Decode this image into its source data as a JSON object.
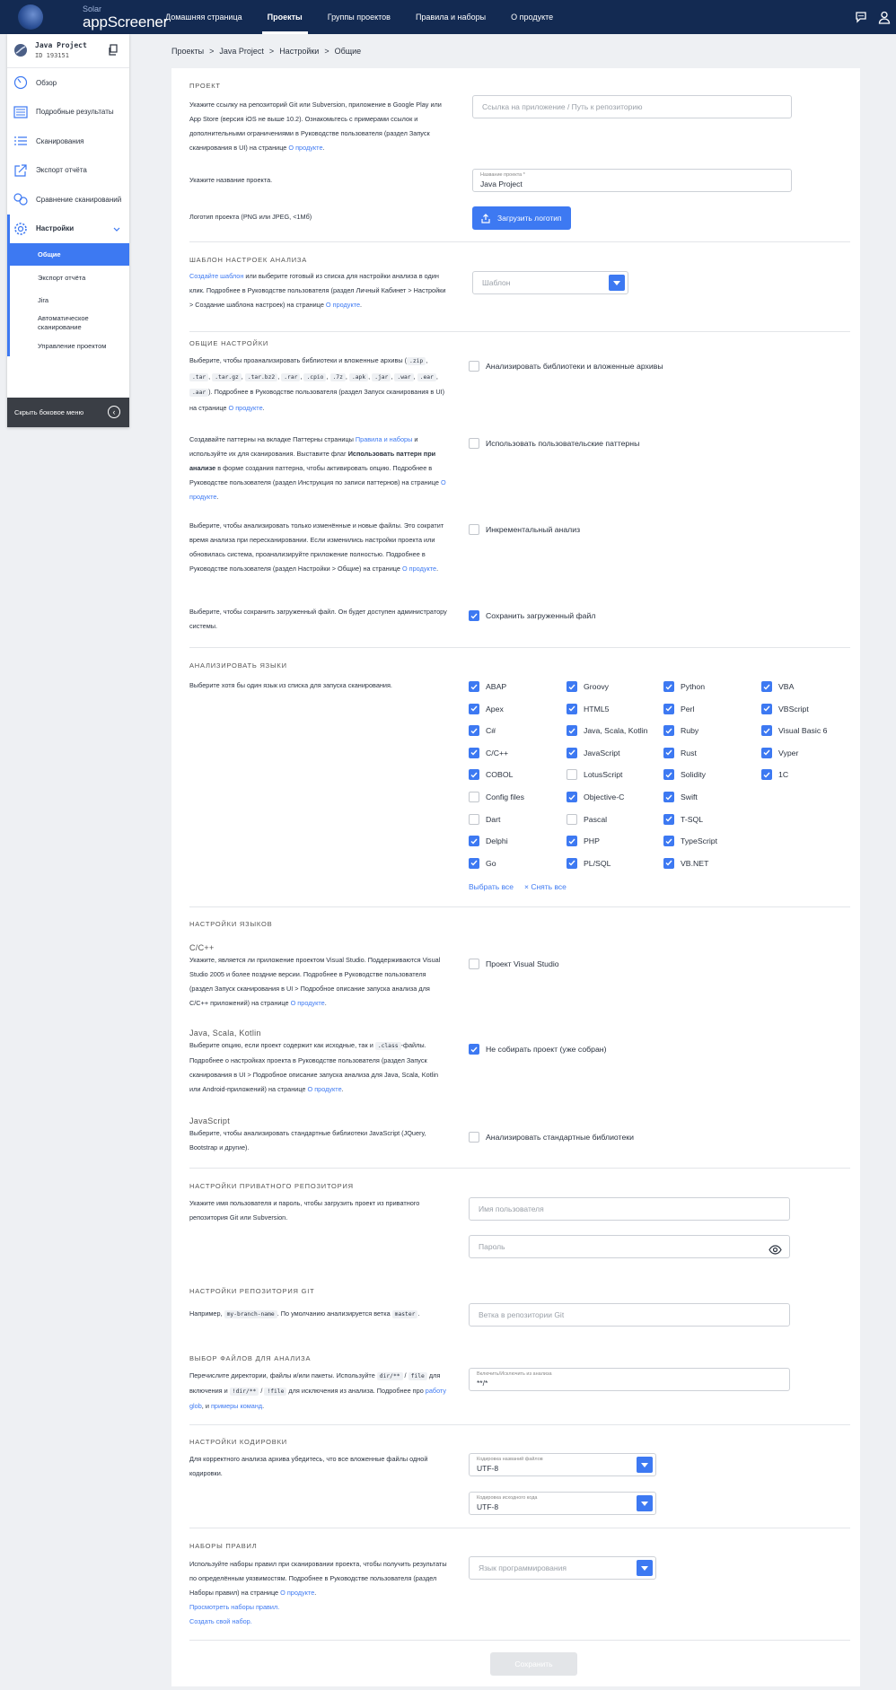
{
  "app": {
    "solar": "Solar",
    "name": "appScreener"
  },
  "topnav": [
    {
      "label": "Домашняя страница",
      "active": false
    },
    {
      "label": "Проекты",
      "active": true
    },
    {
      "label": "Группы проектов",
      "active": false
    },
    {
      "label": "Правила и наборы",
      "active": false
    },
    {
      "label": "О продукте",
      "active": false
    }
  ],
  "topbar_icons": [
    "chat-icon",
    "user-icon"
  ],
  "sidebar": {
    "project_name": "Java Project",
    "project_id": "ID 193151",
    "items": [
      {
        "label": "Обзор",
        "icon": "overview-icon"
      },
      {
        "label": "Подробные результаты",
        "icon": "results-icon"
      },
      {
        "label": "Сканирования",
        "icon": "scans-icon"
      },
      {
        "label": "Экспорт отчёта",
        "icon": "export-icon"
      },
      {
        "label": "Сравнение сканирований",
        "icon": "compare-icon"
      }
    ],
    "settings_label": "Настройки",
    "subitems": [
      {
        "label": "Общие",
        "active": true
      },
      {
        "label": "Экспорт отчёта",
        "active": false
      },
      {
        "label": "Jira",
        "active": false
      },
      {
        "label": "Автоматическое сканирование",
        "active": false
      },
      {
        "label": "Управление проектом",
        "active": false
      }
    ],
    "hide_label": "Скрыть боковое меню"
  },
  "breadcrumb": [
    "Проекты",
    ">",
    "Java Project",
    ">",
    "Настройки",
    ">",
    "Общие"
  ],
  "project_section": {
    "title": "ПРОЕКТ",
    "desc_1": "Укажите ссылку на репозиторий Git или Subversion, приложение в Google Play или App Store (версия iOS не выше 10.2). Ознакомьтесь с примерами ссылок и дополнительными ограничениями в Руководстве пользователя (раздел Запуск сканирования в UI) на странице ",
    "about_link": "О продукте",
    "dot": ".",
    "repo_placeholder": "Ссылка на приложение / Путь к репозиторию",
    "name_desc": "Укажите название проекта.",
    "name_label": "Название проекта *",
    "name_value": "Java Project",
    "logo_desc": "Логотип проекта (PNG или JPEG, <1Мб)",
    "logo_button": "Загрузить логотип"
  },
  "template_section": {
    "title": "ШАБЛОН НАСТРОЕК АНАЛИЗА",
    "link_create": "Создайте шаблон",
    "desc": " или выберите готовый из списка для настройки анализа в один клик. Подробнее в Руководстве пользователя (раздел Личный Кабинет > Настройки > Создание шаблона настроек) на странице ",
    "about_link": "О продукте",
    "dot": ".",
    "select_placeholder": "Шаблон"
  },
  "general_section": {
    "title": "ОБЩИЕ НАСТРОЙКИ",
    "archives_desc_a": "Выберите, чтобы проанализировать библиотеки и вложенные архивы (",
    "archive_exts": [
      ".zip",
      ".tar",
      ".tar.gz",
      ".tar.bz2",
      ".rar",
      ".cpio",
      ".7z",
      ".apk",
      ".jar",
      ".war",
      ".ear",
      ".aar"
    ],
    "archives_desc_b": "). Подробнее в Руководстве пользователя (раздел Запуск сканирования в UI) на странице ",
    "about_link": "О продукте",
    "dot": ".",
    "archives_cb": "Анализировать библиотеки и вложенные архивы",
    "patterns_desc_a": "Создавайте паттерны на вкладке Паттерны страницы ",
    "patterns_link": "Правила и наборы",
    "patterns_desc_b": " и используйте их для сканирования. Выставите флаг ",
    "patterns_bold": "Использовать паттерн при анализе",
    "patterns_desc_c": " в форме создания паттерна, чтобы активировать опцию. Подробнее в Руководстве пользователя (раздел Инструкция по записи паттернов) на странице ",
    "patterns_cb": "Использовать пользовательские паттерны",
    "incr_desc": "Выберите, чтобы анализировать только изменённые и новые файлы. Это сократит время анализа при пересканировании. Если изменились настройки проекта или обновилась система, проанализируйте приложение полностью. Подробнее в Руководстве пользователя (раздел Настройки > Общие) на странице ",
    "incr_cb": "Инкрементальный анализ",
    "save_desc": "Выберите, чтобы сохранить загруженный файл. Он будет доступен администратору системы.",
    "save_cb": "Сохранить загруженный файл"
  },
  "languages_section": {
    "title": "АНАЛИЗИРОВАТЬ ЯЗЫКИ",
    "desc": "Выберите хотя бы один язык из списка для запуска сканирования.",
    "columns": [
      [
        {
          "label": "ABAP",
          "on": true
        },
        {
          "label": "Apex",
          "on": true
        },
        {
          "label": "C#",
          "on": true
        },
        {
          "label": "C/C++",
          "on": true
        },
        {
          "label": "COBOL",
          "on": true
        },
        {
          "label": "Config files",
          "on": false
        },
        {
          "label": "Dart",
          "on": false
        },
        {
          "label": "Delphi",
          "on": true
        },
        {
          "label": "Go",
          "on": true
        }
      ],
      [
        {
          "label": "Groovy",
          "on": true
        },
        {
          "label": "HTML5",
          "on": true
        },
        {
          "label": "Java, Scala, Kotlin",
          "on": true
        },
        {
          "label": "JavaScript",
          "on": true
        },
        {
          "label": "LotusScript",
          "on": false
        },
        {
          "label": "Objective-C",
          "on": true
        },
        {
          "label": "Pascal",
          "on": false
        },
        {
          "label": "PHP",
          "on": true
        },
        {
          "label": "PL/SQL",
          "on": true
        }
      ],
      [
        {
          "label": "Python",
          "on": true
        },
        {
          "label": "Perl",
          "on": true
        },
        {
          "label": "Ruby",
          "on": true
        },
        {
          "label": "Rust",
          "on": true
        },
        {
          "label": "Solidity",
          "on": true
        },
        {
          "label": "Swift",
          "on": true
        },
        {
          "label": "T-SQL",
          "on": true
        },
        {
          "label": "TypeScript",
          "on": true
        },
        {
          "label": "VB.NET",
          "on": true
        }
      ],
      [
        {
          "label": "VBA",
          "on": true
        },
        {
          "label": "VBScript",
          "on": true
        },
        {
          "label": "Visual Basic 6",
          "on": true
        },
        {
          "label": "Vyper",
          "on": true
        },
        {
          "label": "1C",
          "on": true
        }
      ]
    ],
    "select_all": "Выбрать все",
    "deselect_all": "× Снять все"
  },
  "lang_settings_section": {
    "title": "НАСТРОЙКИ ЯЗЫКОВ",
    "cpp_title": "C/C++",
    "cpp_desc": "Укажите, является ли приложение проектом Visual Studio. Поддерживаются Visual Studio 2005 и более поздние версии. Подробнее в Руководстве пользователя (раздел Запуск сканирования в UI > Подробное описание запуска анализа для C/C++ приложений) на странице ",
    "cpp_cb": "Проект Visual Studio",
    "java_title": "Java, Scala, Kotlin",
    "java_desc_a": "Выберите опцию, если проект содержит как исходные, так и ",
    "java_code": ".class",
    "java_desc_b": "-файлы. Подробнее о настройках проекта в Руководстве пользователя (раздел Запуск сканирования в UI > Подробное описание запуска анализа для Java, Scala, Kotlin или Android-приложений) на странице ",
    "java_cb": "Не собирать проект (уже собран)",
    "js_title": "JavaScript",
    "js_desc": "Выберите, чтобы анализировать стандартные библиотеки JavaScript (JQuery, Bootstrap и другие).",
    "js_cb": "Анализировать стандартные библиотеки",
    "about_link": "О продукте",
    "dot": "."
  },
  "private_repo": {
    "title": "НАСТРОЙКИ ПРИВАТНОГО РЕПОЗИТОРИЯ",
    "desc": "Укажите имя пользователя и пароль, чтобы загрузить проект из приватного репозитория Git или Subversion.",
    "username_placeholder": "Имя пользователя",
    "password_placeholder": "Пароль"
  },
  "git": {
    "title": "НАСТРОЙКИ РЕПОЗИТОРИЯ GIT",
    "desc_a": "Например, ",
    "code": "my-branch-name",
    "desc_b": ". По умолчанию анализируется ветка ",
    "code2": "master",
    "dot": ".",
    "placeholder": "Ветка в репозитории Git"
  },
  "files": {
    "title": "ВЫБОР ФАЙЛОВ ДЛЯ АНАЛИЗА",
    "desc_a": "Перечислите директории, файлы и/или пакеты. Используйте ",
    "code1": "dir/**",
    "slash": " / ",
    "code2": "file",
    "desc_b": " для включения и ",
    "code3": "!dir/**",
    "code4": "!file",
    "desc_c": " для исключения из анализа. Подробнее про ",
    "link1": "работу glob",
    "desc_d": ", и ",
    "link2": "примеры команд",
    "dot": ".",
    "field_label": "Включить/Исключить из анализа",
    "field_value": "**/*"
  },
  "encoding": {
    "title": "НАСТРОЙКИ КОДИРОВКИ",
    "desc": "Для корректного анализа архива убедитесь, что все вложенные файлы одной кодировки.",
    "filenames_label": "Кодировка названий файлов",
    "filenames_value": "UTF-8",
    "source_label": "Кодировка исходного кода",
    "source_value": "UTF-8"
  },
  "rulesets": {
    "title": "НАБОРЫ ПРАВИЛ",
    "desc": "Используйте наборы правил при сканировании проекта, чтобы получить результаты по определённым уязвимостям. Подробнее в Руководстве пользователя (раздел Наборы правил) на странице ",
    "about_link": "О продукте",
    "dot": ".",
    "link_view": "Просмотреть наборы правил.",
    "link_create": "Создать свой набор.",
    "placeholder": "Язык программирования"
  },
  "save_button": "Сохранить",
  "colors": {
    "topbar": "#132a52",
    "accent": "#3d79f2",
    "hidebar": "#3a3e45"
  }
}
